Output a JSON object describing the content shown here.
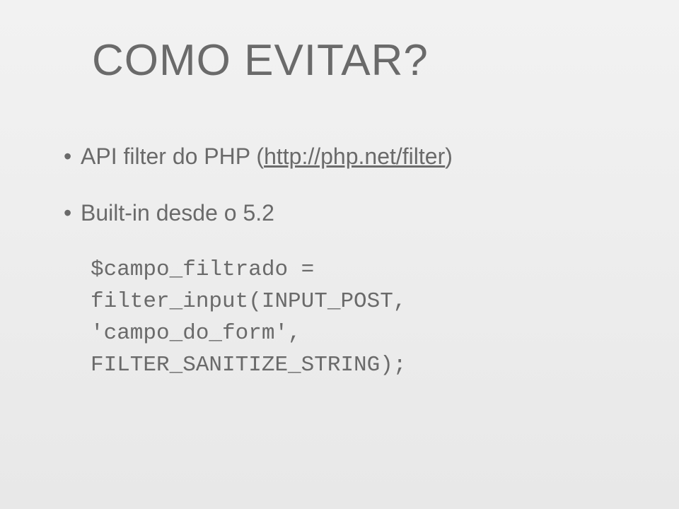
{
  "slide": {
    "title": "COMO EVITAR?",
    "bullets": [
      {
        "prefix": "API filter do PHP (",
        "link": "http://php.net/filter",
        "suffix": ")"
      },
      {
        "text": "Built-in desde o 5.2"
      }
    ],
    "code": "$campo_filtrado = filter_input(INPUT_POST, 'campo_do_form', FILTER_SANITIZE_STRING);"
  }
}
